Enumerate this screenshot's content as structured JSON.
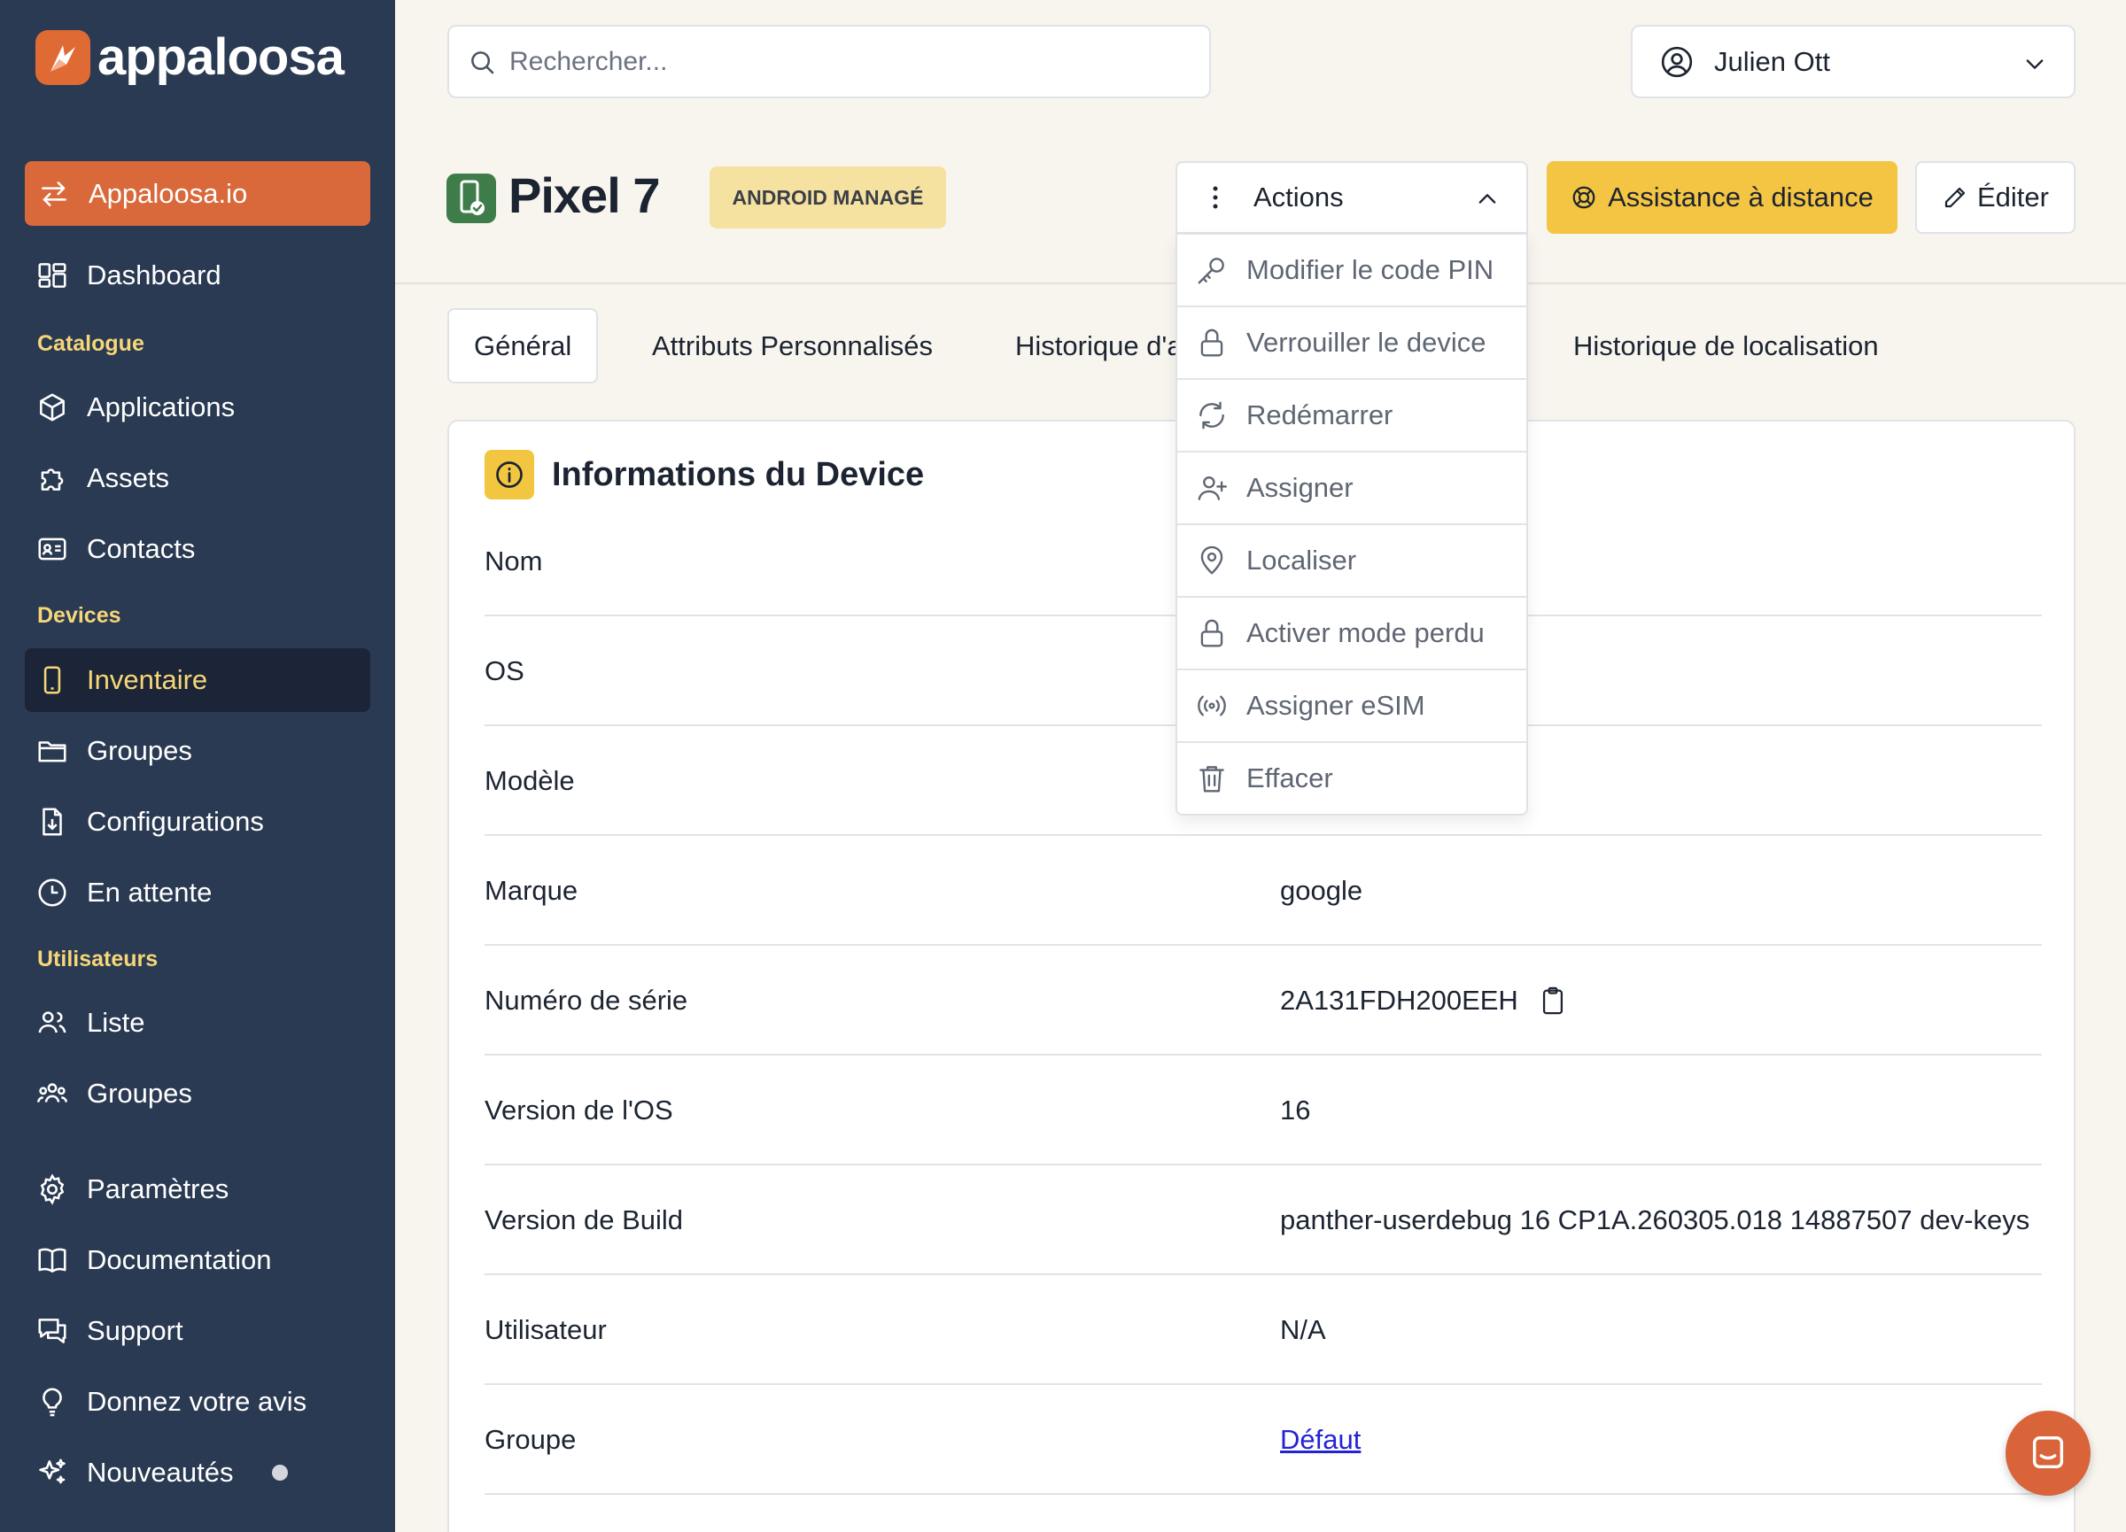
{
  "app": {
    "name": "appaloosa"
  },
  "colors": {
    "sidebar": "#2a3a52",
    "accent": "#df6a34",
    "section": "#f6d778",
    "primary_button": "#f4c542",
    "badge": "#f6e2a0",
    "link": "#2323d6"
  },
  "sidebar": {
    "org_switch": {
      "label": "Appaloosa.io",
      "icon": "switch-arrows-icon"
    },
    "top_items": [
      {
        "label": "Dashboard",
        "icon": "dashboard-icon"
      }
    ],
    "sections": {
      "catalogue": "Catalogue",
      "devices": "Devices",
      "utilisateurs": "Utilisateurs"
    },
    "catalogue_items": [
      {
        "label": "Applications",
        "icon": "cube-icon"
      },
      {
        "label": "Assets",
        "icon": "puzzle-icon"
      },
      {
        "label": "Contacts",
        "icon": "contact-card-icon"
      }
    ],
    "devices_items": [
      {
        "label": "Inventaire",
        "icon": "phone-icon",
        "active": true
      },
      {
        "label": "Groupes",
        "icon": "folder-icon"
      },
      {
        "label": "Configurations",
        "icon": "file-download-icon"
      },
      {
        "label": "En attente",
        "icon": "clock-icon"
      }
    ],
    "users_items": [
      {
        "label": "Liste",
        "icon": "users-icon"
      },
      {
        "label": "Groupes",
        "icon": "user-group-icon"
      }
    ],
    "bottom_items": [
      {
        "label": "Paramètres",
        "icon": "gear-icon"
      },
      {
        "label": "Documentation",
        "icon": "book-icon"
      },
      {
        "label": "Support",
        "icon": "chat-bubbles-icon"
      },
      {
        "label": "Donnez votre avis",
        "icon": "lightbulb-icon"
      },
      {
        "label": "Nouveautés",
        "icon": "sparkles-icon"
      }
    ]
  },
  "search": {
    "placeholder": "Rechercher..."
  },
  "user": {
    "name": "Julien Ott"
  },
  "header": {
    "title": "Pixel 7",
    "badge": "ANDROID MANAGÉ",
    "actions_label": "Actions",
    "remote_label": "Assistance à distance",
    "edit_label": "Éditer"
  },
  "tabs": [
    {
      "label": "Général",
      "active": true
    },
    {
      "label": "Attributs Personnalisés"
    },
    {
      "label": "Historique d'a"
    },
    {
      "label": "Historique de localisation"
    }
  ],
  "actions_menu": [
    {
      "label": "Modifier le code PIN",
      "icon": "key-icon"
    },
    {
      "label": "Verrouiller le device",
      "icon": "lock-icon"
    },
    {
      "label": "Redémarrer",
      "icon": "refresh-icon"
    },
    {
      "label": "Assigner",
      "icon": "user-plus-icon"
    },
    {
      "label": "Localiser",
      "icon": "map-pin-icon"
    },
    {
      "label": "Activer mode perdu",
      "icon": "lock-icon"
    },
    {
      "label": "Assigner eSIM",
      "icon": "broadcast-icon"
    },
    {
      "label": "Effacer",
      "icon": "trash-icon"
    }
  ],
  "device_info": {
    "title": "Informations du Device",
    "rows": [
      {
        "label": "Nom",
        "value": ""
      },
      {
        "label": "OS",
        "value": ""
      },
      {
        "label": "Modèle",
        "value": ""
      },
      {
        "label": "Marque",
        "value": "google"
      },
      {
        "label": "Numéro de série",
        "value": "2A131FDH200EEH"
      },
      {
        "label": "Version de l'OS",
        "value": "16"
      },
      {
        "label": "Version de Build",
        "value": "panther-userdebug 16 CP1A.260305.018 14887507 dev-keys"
      },
      {
        "label": "Utilisateur",
        "value": "N/A"
      },
      {
        "label": "Groupe",
        "value": "Défaut"
      }
    ]
  }
}
